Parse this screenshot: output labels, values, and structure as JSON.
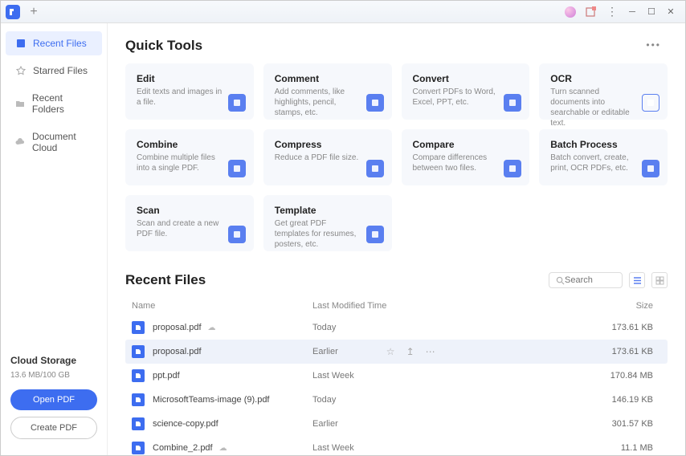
{
  "sidebar": {
    "items": [
      {
        "label": "Recent Files"
      },
      {
        "label": "Starred Files"
      },
      {
        "label": "Recent Folders"
      },
      {
        "label": "Document Cloud"
      }
    ],
    "cloud": {
      "title": "Cloud Storage",
      "usage": "13.6 MB/100 GB",
      "open_label": "Open PDF",
      "create_label": "Create PDF"
    }
  },
  "main": {
    "quick_tools_title": "Quick Tools",
    "tools": [
      {
        "title": "Edit",
        "desc": "Edit texts and images in a file."
      },
      {
        "title": "Comment",
        "desc": "Add comments, like highlights, pencil, stamps, etc."
      },
      {
        "title": "Convert",
        "desc": "Convert PDFs to Word, Excel, PPT, etc."
      },
      {
        "title": "OCR",
        "desc": "Turn scanned documents into searchable or editable text."
      },
      {
        "title": "Combine",
        "desc": "Combine multiple files into a single PDF."
      },
      {
        "title": "Compress",
        "desc": "Reduce a PDF file size."
      },
      {
        "title": "Compare",
        "desc": "Compare differences between two files."
      },
      {
        "title": "Batch Process",
        "desc": "Batch convert, create, print, OCR PDFs, etc."
      },
      {
        "title": "Scan",
        "desc": "Scan and create a new PDF file."
      },
      {
        "title": "Template",
        "desc": "Get great PDF templates for resumes, posters, etc."
      }
    ],
    "recent_title": "Recent Files",
    "search_placeholder": "Search",
    "columns": {
      "name": "Name",
      "modified": "Last Modified Time",
      "size": "Size"
    },
    "files": [
      {
        "name": "proposal.pdf",
        "modified": "Today",
        "size": "173.61 KB",
        "cloud": true
      },
      {
        "name": "proposal.pdf",
        "modified": "Earlier",
        "size": "173.61 KB",
        "hover": true
      },
      {
        "name": "ppt.pdf",
        "modified": "Last Week",
        "size": "170.84 MB"
      },
      {
        "name": "MicrosoftTeams-image (9).pdf",
        "modified": "Today",
        "size": "146.19 KB"
      },
      {
        "name": "science-copy.pdf",
        "modified": "Earlier",
        "size": "301.57 KB"
      },
      {
        "name": "Combine_2.pdf",
        "modified": "Last Week",
        "size": "11.1 MB",
        "cloud": true
      }
    ]
  }
}
